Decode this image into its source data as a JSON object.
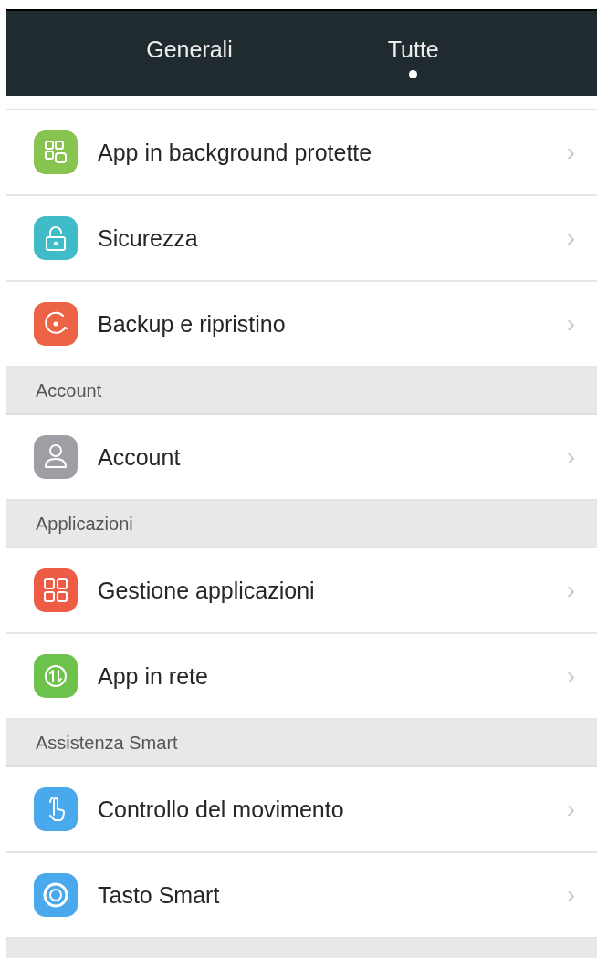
{
  "tabs": [
    {
      "label": "Generali",
      "selected": false
    },
    {
      "label": "Tutte",
      "selected": true
    }
  ],
  "sections": [
    {
      "items": [
        {
          "label": "App in background protette",
          "kind": "apps",
          "color": "#86c44f",
          "chevron": "›"
        },
        {
          "label": "Sicurezza",
          "kind": "lock",
          "color": "#3fbcc8",
          "chevron": "›"
        },
        {
          "label": "Backup e ripristino",
          "kind": "restore",
          "color": "#ec6346",
          "chevron": "›"
        }
      ]
    },
    {
      "header": "Account",
      "items": [
        {
          "label": "Account",
          "kind": "person",
          "color": "#9d9fa4",
          "chevron": "›"
        }
      ]
    },
    {
      "header": "Applicazioni",
      "items": [
        {
          "label": "Gestione applicazioni",
          "kind": "grid",
          "color": "#ee5c45",
          "chevron": "›"
        },
        {
          "label": "App in rete",
          "kind": "network",
          "color": "#6dc24b",
          "chevron": "›"
        }
      ]
    },
    {
      "header": "Assistenza Smart",
      "items": [
        {
          "label": "Controllo del movimento",
          "kind": "gesture",
          "color": "#4aa8ec",
          "chevron": "›"
        },
        {
          "label": "Tasto Smart",
          "kind": "button",
          "color": "#4aa8ec",
          "chevron": "›"
        }
      ]
    }
  ]
}
